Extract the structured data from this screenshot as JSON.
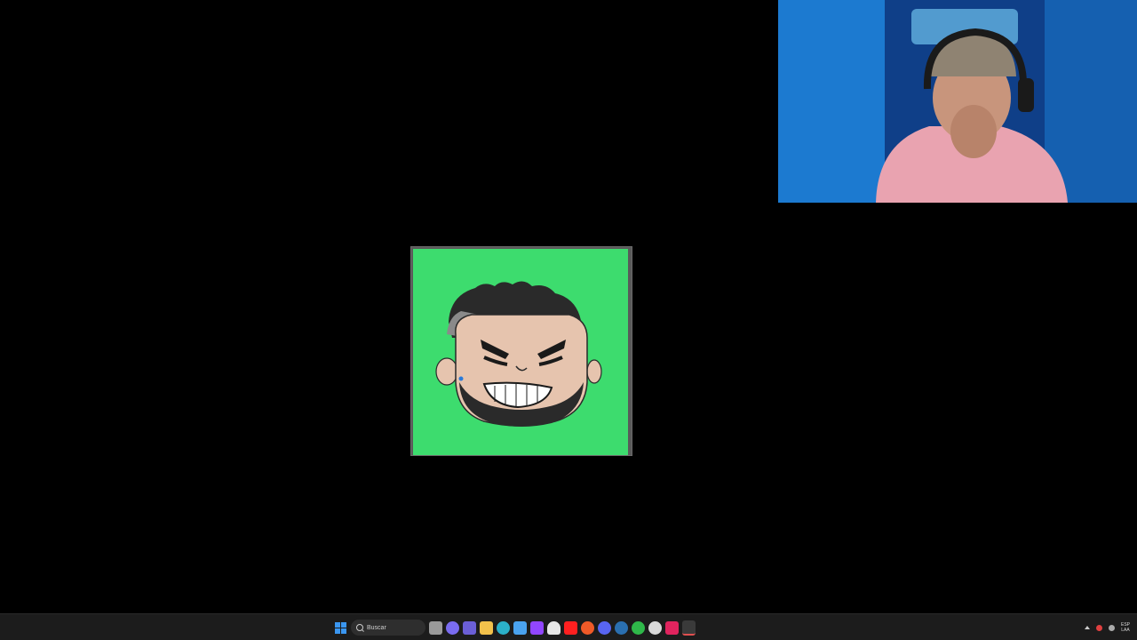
{
  "taskbar": {
    "search_placeholder": "Buscar",
    "language_line1": "ESP",
    "language_line2": "LAA",
    "pinned_icons": [
      {
        "name": "task-view-icon",
        "color": "#9a9a9a"
      },
      {
        "name": "copilot-icon",
        "color": "#7a6cf0"
      },
      {
        "name": "teams-icon",
        "color": "#6b5fd6"
      },
      {
        "name": "file-explorer-icon",
        "color": "#f2c14b"
      },
      {
        "name": "edge-icon",
        "color": "#2bb0c8"
      },
      {
        "name": "store-icon",
        "color": "#4aa3f0"
      },
      {
        "name": "twitch-icon",
        "color": "#9146ff"
      },
      {
        "name": "ghost-app-icon",
        "color": "#e8e8e8"
      },
      {
        "name": "youtube-icon",
        "color": "#ff2020"
      },
      {
        "name": "brave-icon",
        "color": "#f05a28"
      },
      {
        "name": "discord-icon",
        "color": "#5865f2"
      },
      {
        "name": "steam-icon",
        "color": "#2a6fb0"
      },
      {
        "name": "xbox-icon",
        "color": "#2fb84a"
      },
      {
        "name": "chrome-icon",
        "color": "#d9d9d9"
      },
      {
        "name": "tiktok-icon",
        "color": "#e0245e"
      },
      {
        "name": "obs-active-icon",
        "color": "#e0e0e0"
      }
    ]
  },
  "colors": {
    "canvas_green": "#3ddc6e",
    "webcam_blue": "#1470c8"
  }
}
